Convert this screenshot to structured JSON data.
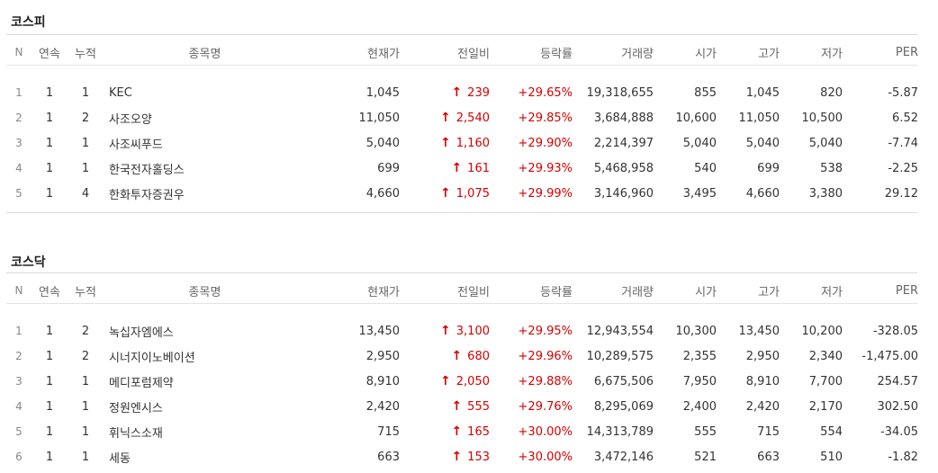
{
  "kospi": {
    "title": "코스피",
    "headers": [
      "N",
      "연속",
      "누적",
      "종목명",
      "현재가",
      "전일비",
      "등락률",
      "거래량",
      "시가",
      "고가",
      "저가",
      "PER"
    ],
    "rows": [
      {
        "n": "1",
        "cont": "1",
        "cum": "1",
        "name": "KEC",
        "price": "1,045",
        "diff": "239",
        "rate": "+29.65%",
        "vol": "19,318,655",
        "open": "855",
        "high": "1,045",
        "low": "820",
        "per": "-5.87"
      },
      {
        "n": "2",
        "cont": "1",
        "cum": "2",
        "name": "사조오양",
        "price": "11,050",
        "diff": "2,540",
        "rate": "+29.85%",
        "vol": "3,684,888",
        "open": "10,600",
        "high": "11,050",
        "low": "10,500",
        "per": "6.52"
      },
      {
        "n": "3",
        "cont": "1",
        "cum": "1",
        "name": "사조씨푸드",
        "price": "5,040",
        "diff": "1,160",
        "rate": "+29.90%",
        "vol": "2,214,397",
        "open": "5,040",
        "high": "5,040",
        "low": "5,040",
        "per": "-7.74"
      },
      {
        "n": "4",
        "cont": "1",
        "cum": "1",
        "name": "한국전자홀딩스",
        "price": "699",
        "diff": "161",
        "rate": "+29.93%",
        "vol": "5,468,958",
        "open": "540",
        "high": "699",
        "low": "538",
        "per": "-2.25"
      },
      {
        "n": "5",
        "cont": "1",
        "cum": "4",
        "name": "한화투자증권우",
        "price": "4,660",
        "diff": "1,075",
        "rate": "+29.99%",
        "vol": "3,146,960",
        "open": "3,495",
        "high": "4,660",
        "low": "3,380",
        "per": "29.12"
      }
    ]
  },
  "kosdaq": {
    "title": "코스닥",
    "headers": [
      "N",
      "연속",
      "누적",
      "종목명",
      "현재가",
      "전일비",
      "등락률",
      "거래량",
      "시가",
      "고가",
      "저가",
      "PER"
    ],
    "rows": [
      {
        "n": "1",
        "cont": "1",
        "cum": "2",
        "name": "녹십자엠에스",
        "price": "13,450",
        "diff": "3,100",
        "rate": "+29.95%",
        "vol": "12,943,554",
        "open": "10,300",
        "high": "13,450",
        "low": "10,200",
        "per": "-328.05"
      },
      {
        "n": "2",
        "cont": "1",
        "cum": "2",
        "name": "시너지이노베이션",
        "price": "2,950",
        "diff": "680",
        "rate": "+29.96%",
        "vol": "10,289,575",
        "open": "2,355",
        "high": "2,950",
        "low": "2,340",
        "per": "-1,475.00"
      },
      {
        "n": "3",
        "cont": "1",
        "cum": "1",
        "name": "메디포럼제약",
        "price": "8,910",
        "diff": "2,050",
        "rate": "+29.88%",
        "vol": "6,675,506",
        "open": "7,950",
        "high": "8,910",
        "low": "7,700",
        "per": "254.57"
      },
      {
        "n": "4",
        "cont": "1",
        "cum": "1",
        "name": "정원엔시스",
        "price": "2,420",
        "diff": "555",
        "rate": "+29.76%",
        "vol": "8,295,069",
        "open": "2,400",
        "high": "2,420",
        "low": "2,170",
        "per": "302.50"
      },
      {
        "n": "5",
        "cont": "1",
        "cum": "1",
        "name": "휘닉스소재",
        "price": "715",
        "diff": "165",
        "rate": "+30.00%",
        "vol": "14,313,789",
        "open": "555",
        "high": "715",
        "low": "554",
        "per": "-34.05"
      },
      {
        "n": "6",
        "cont": "1",
        "cum": "1",
        "name": "세동",
        "price": "663",
        "diff": "153",
        "rate": "+30.00%",
        "vol": "3,472,146",
        "open": "521",
        "high": "663",
        "low": "510",
        "per": "-1.82"
      }
    ]
  },
  "icons": {
    "up_arrow": "up-arrow-icon",
    "up_color": "#d60000"
  }
}
